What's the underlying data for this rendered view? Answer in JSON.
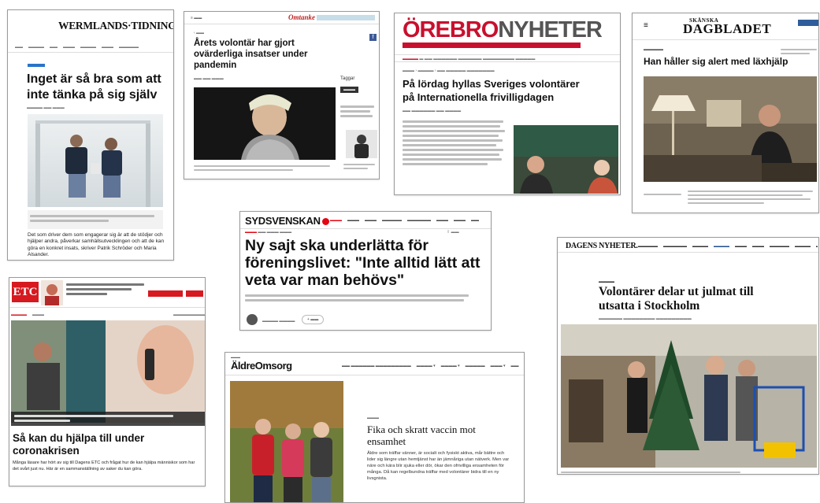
{
  "colors": {
    "orebro_red": "#c8102e",
    "sydsvenskan_red": "#e30613",
    "etc_red": "#d71920",
    "dn_blue": "#1f4d8c",
    "wt_accent": "#2a74c9"
  },
  "wermlands": {
    "logo": "WERMLANDS·TIDNINGEN",
    "headline": "Inget är så bra som att inte tänka på sig själv",
    "body": "Det som driver dem som engagerar sig är att de stödjer och hjälper andra, påverkar samhällsutvecklingen och att de kan göra en konkret insats, skriver Patrik Schröder och Maria Alsander."
  },
  "omtanke": {
    "brand": "Omtanke",
    "headline": "Årets volontär har gjort ovärderliga insatser under pandemin",
    "side_title": "Taggar",
    "facebook_icon": "f"
  },
  "orebro": {
    "logo_red": "ÖREBRO",
    "logo_grey": "NYHETER",
    "headline": "På lördag hyllas Sveriges volontärer på Internationella frivilligdagen"
  },
  "skanska": {
    "logo_top": "SKÅNSKA",
    "logo": "DAGBLADET",
    "menu_icon": "≡",
    "headline": "Han håller sig alert med läxhjälp"
  },
  "sydsvenskan": {
    "logo": "SYDSVENSKAN",
    "headline": "Ny sajt ska underlätta för föreningslivet: \"Inte alltid lätt att veta var man behövs\""
  },
  "etc": {
    "logo": "ETC",
    "headline": "Så kan du hjälpa till under coronakrisen",
    "body": "Många läsare har hört av sig till Dagens ETC och frågat hur de kan hjälpa människor som har det svårt just nu. Här är en sammanställning av saker du kan göra."
  },
  "aldreomsorg": {
    "logo": "ÄldreOmsorg",
    "headline": "Fika och skratt vaccin mot ensamhet",
    "body": "Äldre som träffar vänner, är socialt och fysiskt aktiva, mår bättre och lider sig längre utan hemtjänst har än jämnåriga utan nätverk. Men var näre och kära blir sjuka eller dör, ökar den ofrivilliga ensamheten för många. Då kan regelbundna träffar med volontärer bidra till en ny livsgnista."
  },
  "dn": {
    "logo": "DAGENS NYHETER.",
    "headline": "Volontärer delar ut julmat till utsatta i Stockholm"
  }
}
